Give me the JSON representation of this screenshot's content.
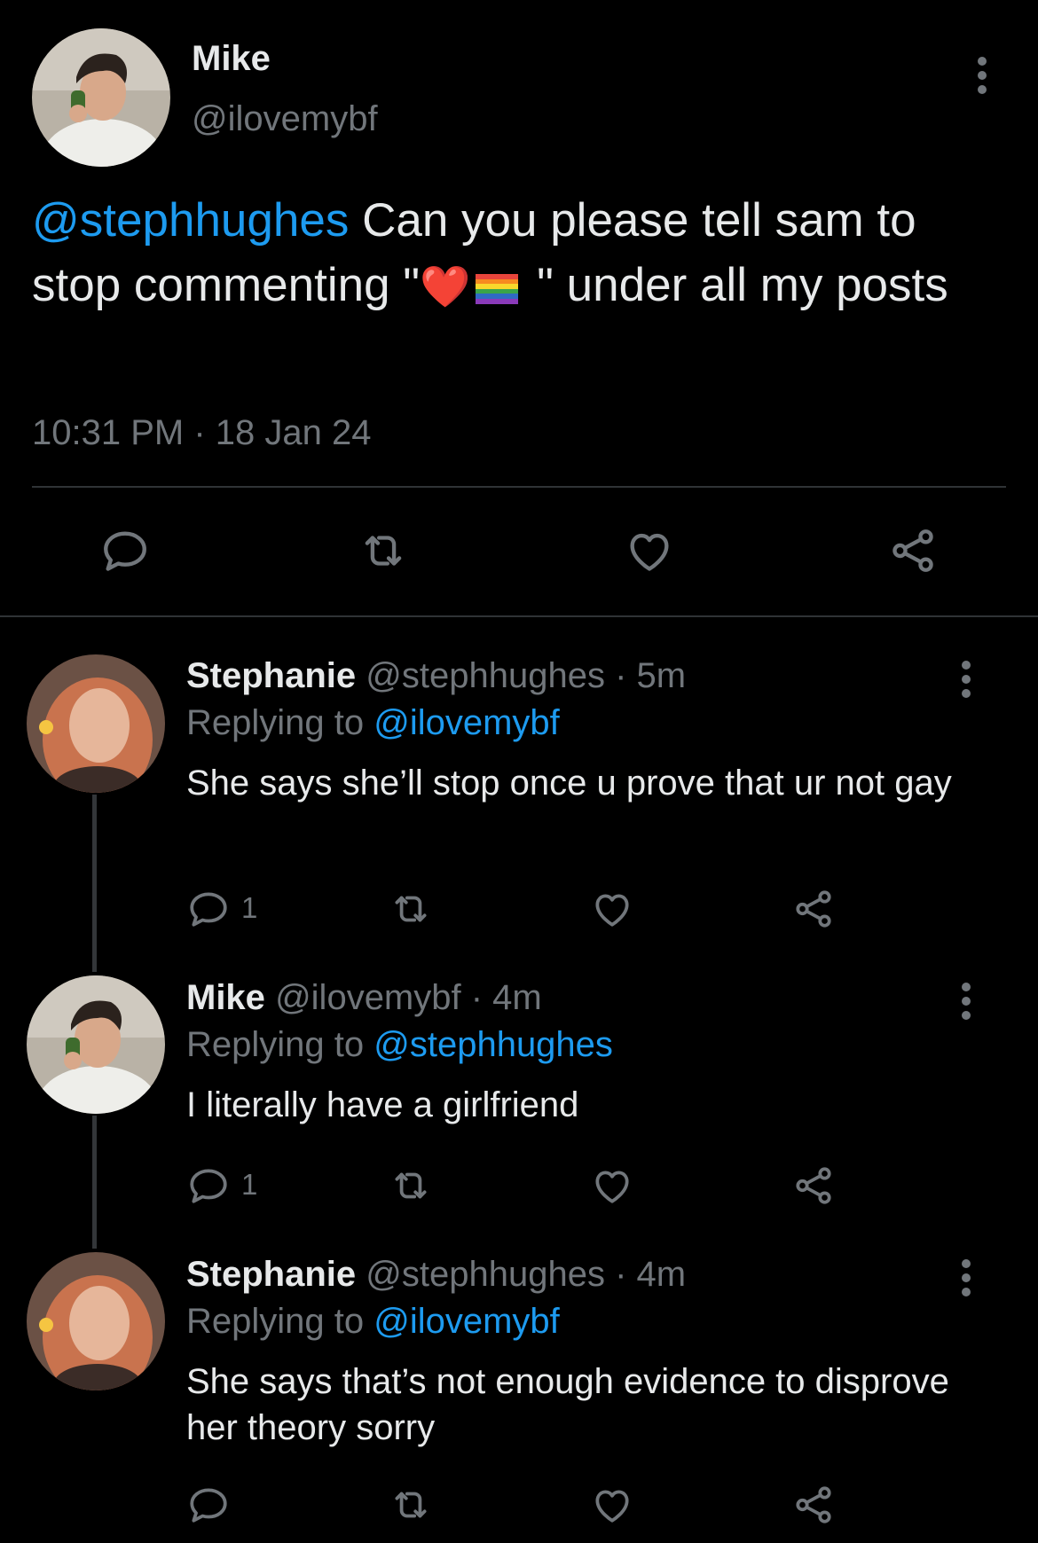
{
  "main_tweet": {
    "name": "Mike",
    "handle": "@ilovemybf",
    "mention": "@stephhughes",
    "text_part1": " Can you please tell sam to stop commenting \"",
    "emoji_1": "❤️",
    "text_part2": " \" under all my posts",
    "timestamp": "10:31 PM · 18 Jan 24"
  },
  "replies": [
    {
      "name": "Stephanie",
      "handle_time": "@stephhughes · 5m",
      "replying_prefix": "Replying to ",
      "replying_to": "@ilovemybf",
      "text": "She says she’ll stop once u prove that ur not gay",
      "reply_count": "1"
    },
    {
      "name": "Mike",
      "handle_time": "@ilovemybf · 4m",
      "replying_prefix": "Replying to ",
      "replying_to": "@stephhughes",
      "text": "I literally have a girlfriend",
      "reply_count": "1"
    },
    {
      "name": "Stephanie",
      "handle_time": "@stephhughes · 4m",
      "replying_prefix": "Replying to ",
      "replying_to": "@ilovemybf",
      "text": "She says that’s not enough evidence to disprove her theory sorry",
      "reply_count": ""
    }
  ],
  "icons": [
    "reply-icon",
    "retweet-icon",
    "like-icon",
    "share-icon",
    "more-icon"
  ],
  "colors": {
    "background": "#000000",
    "text": "#e7e9ea",
    "muted": "#71767b",
    "accent": "#1d9bf0",
    "divider": "#2f3336"
  }
}
